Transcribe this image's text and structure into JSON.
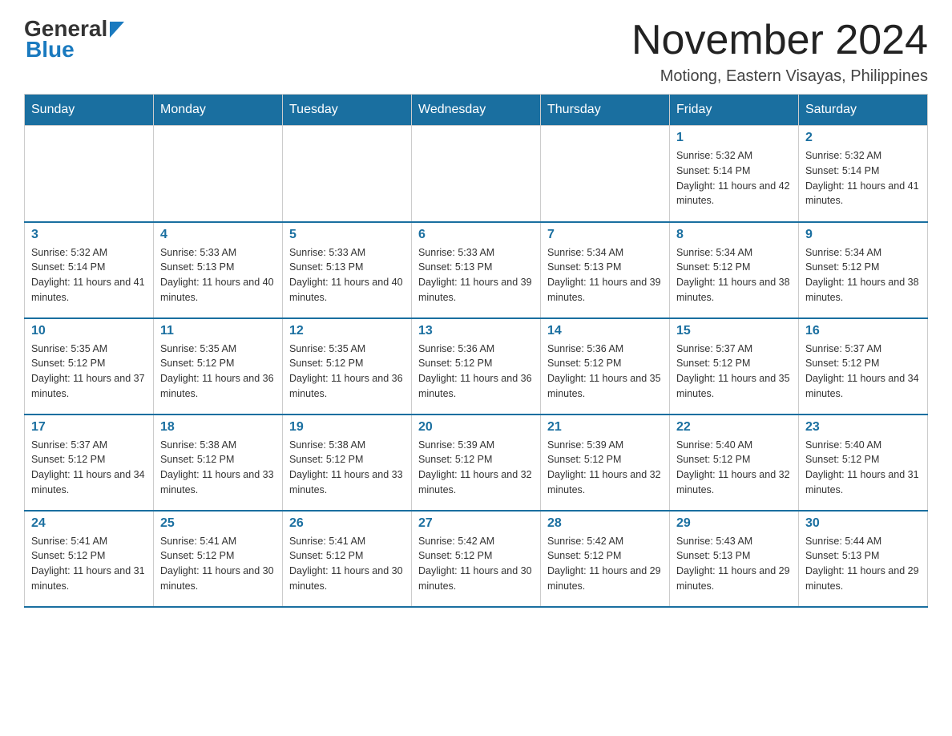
{
  "logo": {
    "general": "General",
    "blue": "Blue"
  },
  "header": {
    "month_title": "November 2024",
    "location": "Motiong, Eastern Visayas, Philippines"
  },
  "days_of_week": [
    "Sunday",
    "Monday",
    "Tuesday",
    "Wednesday",
    "Thursday",
    "Friday",
    "Saturday"
  ],
  "weeks": [
    [
      {
        "day": "",
        "info": ""
      },
      {
        "day": "",
        "info": ""
      },
      {
        "day": "",
        "info": ""
      },
      {
        "day": "",
        "info": ""
      },
      {
        "day": "",
        "info": ""
      },
      {
        "day": "1",
        "info": "Sunrise: 5:32 AM\nSunset: 5:14 PM\nDaylight: 11 hours and 42 minutes."
      },
      {
        "day": "2",
        "info": "Sunrise: 5:32 AM\nSunset: 5:14 PM\nDaylight: 11 hours and 41 minutes."
      }
    ],
    [
      {
        "day": "3",
        "info": "Sunrise: 5:32 AM\nSunset: 5:14 PM\nDaylight: 11 hours and 41 minutes."
      },
      {
        "day": "4",
        "info": "Sunrise: 5:33 AM\nSunset: 5:13 PM\nDaylight: 11 hours and 40 minutes."
      },
      {
        "day": "5",
        "info": "Sunrise: 5:33 AM\nSunset: 5:13 PM\nDaylight: 11 hours and 40 minutes."
      },
      {
        "day": "6",
        "info": "Sunrise: 5:33 AM\nSunset: 5:13 PM\nDaylight: 11 hours and 39 minutes."
      },
      {
        "day": "7",
        "info": "Sunrise: 5:34 AM\nSunset: 5:13 PM\nDaylight: 11 hours and 39 minutes."
      },
      {
        "day": "8",
        "info": "Sunrise: 5:34 AM\nSunset: 5:12 PM\nDaylight: 11 hours and 38 minutes."
      },
      {
        "day": "9",
        "info": "Sunrise: 5:34 AM\nSunset: 5:12 PM\nDaylight: 11 hours and 38 minutes."
      }
    ],
    [
      {
        "day": "10",
        "info": "Sunrise: 5:35 AM\nSunset: 5:12 PM\nDaylight: 11 hours and 37 minutes."
      },
      {
        "day": "11",
        "info": "Sunrise: 5:35 AM\nSunset: 5:12 PM\nDaylight: 11 hours and 36 minutes."
      },
      {
        "day": "12",
        "info": "Sunrise: 5:35 AM\nSunset: 5:12 PM\nDaylight: 11 hours and 36 minutes."
      },
      {
        "day": "13",
        "info": "Sunrise: 5:36 AM\nSunset: 5:12 PM\nDaylight: 11 hours and 36 minutes."
      },
      {
        "day": "14",
        "info": "Sunrise: 5:36 AM\nSunset: 5:12 PM\nDaylight: 11 hours and 35 minutes."
      },
      {
        "day": "15",
        "info": "Sunrise: 5:37 AM\nSunset: 5:12 PM\nDaylight: 11 hours and 35 minutes."
      },
      {
        "day": "16",
        "info": "Sunrise: 5:37 AM\nSunset: 5:12 PM\nDaylight: 11 hours and 34 minutes."
      }
    ],
    [
      {
        "day": "17",
        "info": "Sunrise: 5:37 AM\nSunset: 5:12 PM\nDaylight: 11 hours and 34 minutes."
      },
      {
        "day": "18",
        "info": "Sunrise: 5:38 AM\nSunset: 5:12 PM\nDaylight: 11 hours and 33 minutes."
      },
      {
        "day": "19",
        "info": "Sunrise: 5:38 AM\nSunset: 5:12 PM\nDaylight: 11 hours and 33 minutes."
      },
      {
        "day": "20",
        "info": "Sunrise: 5:39 AM\nSunset: 5:12 PM\nDaylight: 11 hours and 32 minutes."
      },
      {
        "day": "21",
        "info": "Sunrise: 5:39 AM\nSunset: 5:12 PM\nDaylight: 11 hours and 32 minutes."
      },
      {
        "day": "22",
        "info": "Sunrise: 5:40 AM\nSunset: 5:12 PM\nDaylight: 11 hours and 32 minutes."
      },
      {
        "day": "23",
        "info": "Sunrise: 5:40 AM\nSunset: 5:12 PM\nDaylight: 11 hours and 31 minutes."
      }
    ],
    [
      {
        "day": "24",
        "info": "Sunrise: 5:41 AM\nSunset: 5:12 PM\nDaylight: 11 hours and 31 minutes."
      },
      {
        "day": "25",
        "info": "Sunrise: 5:41 AM\nSunset: 5:12 PM\nDaylight: 11 hours and 30 minutes."
      },
      {
        "day": "26",
        "info": "Sunrise: 5:41 AM\nSunset: 5:12 PM\nDaylight: 11 hours and 30 minutes."
      },
      {
        "day": "27",
        "info": "Sunrise: 5:42 AM\nSunset: 5:12 PM\nDaylight: 11 hours and 30 minutes."
      },
      {
        "day": "28",
        "info": "Sunrise: 5:42 AM\nSunset: 5:12 PM\nDaylight: 11 hours and 29 minutes."
      },
      {
        "day": "29",
        "info": "Sunrise: 5:43 AM\nSunset: 5:13 PM\nDaylight: 11 hours and 29 minutes."
      },
      {
        "day": "30",
        "info": "Sunrise: 5:44 AM\nSunset: 5:13 PM\nDaylight: 11 hours and 29 minutes."
      }
    ]
  ]
}
